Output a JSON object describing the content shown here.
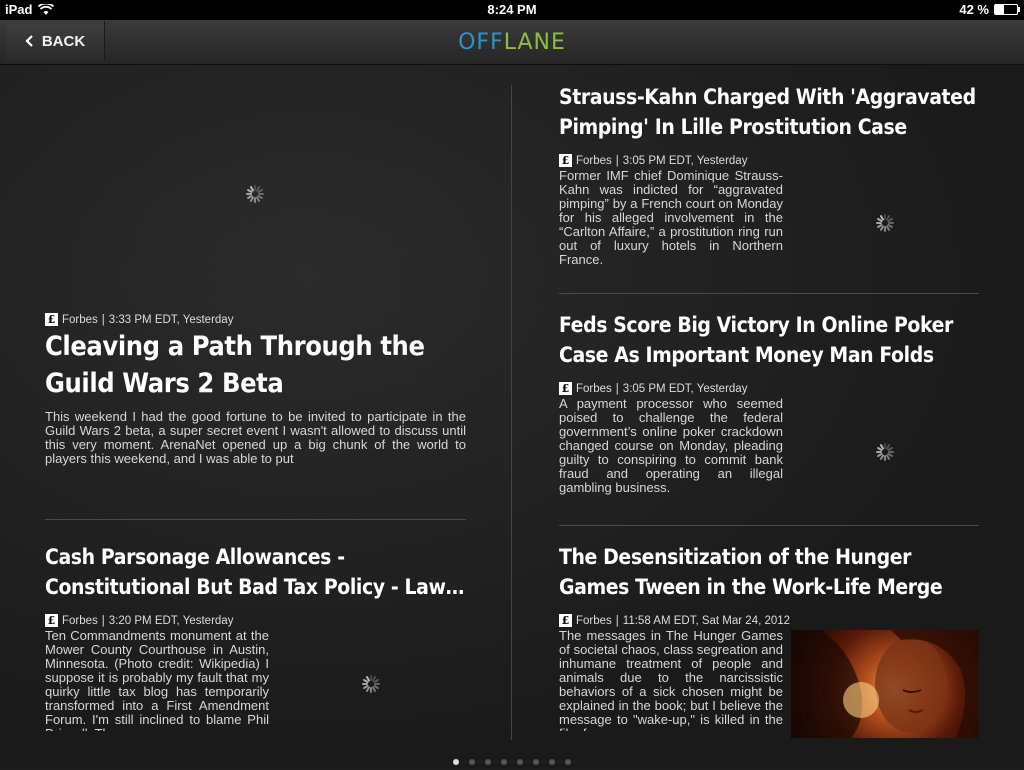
{
  "status_bar": {
    "device": "iPad",
    "time": "8:24 PM",
    "battery": "42 %",
    "battery_level": 0.42
  },
  "nav": {
    "back_label": "BACK",
    "logo_part1": "OFF",
    "logo_part2": "LANE"
  },
  "colors": {
    "logo_blue": "#2b95c9",
    "logo_green": "#8cbf3f"
  },
  "articles": [
    {
      "title": "Cleaving a Path Through the Guild Wars 2 Beta",
      "source": "Forbes",
      "time": "3:33 PM EDT, Yesterday",
      "body": "This weekend I had the good fortune to be invited to participate in the Guild Wars 2 beta, a super secret event I wasn't allowed to discuss until this very moment. ArenaNet opened up a big chunk of the world to players this weekend, and I was able to put"
    },
    {
      "title": "Strauss-Kahn Charged With 'Aggravated Pimping' In Lille Prostitution Case",
      "source": "Forbes",
      "time": "3:05 PM EDT, Yesterday",
      "body": "Former IMF chief Dominique Strauss-Kahn was indicted for “aggravated pimping” by a French court on Monday for his alleged involvement in the “Carlton Affaire,” a prostitution ring run out of luxury hotels in Northern France."
    },
    {
      "title": "Feds Score Big Victory In Online Poker Case As Important Money Man Folds",
      "source": "Forbes",
      "time": "3:05 PM EDT, Yesterday",
      "body": "A payment processor who seemed poised to challenge the federal government’s online poker crackdown changed course on Monday, pleading guilty to conspiring to commit bank fraud and operating an illegal gambling business."
    },
    {
      "title": "Cash Parsonage Allowances - Constitutional But Bad Tax Policy - Law…",
      "source": "Forbes",
      "time": "3:20 PM EDT, Yesterday",
      "body": "Ten Commandments monument at the Mower County Courthouse in Austin, Minnesota. (Photo credit: Wikipedia) I suppose it is probably my fault that my quirky little tax blog has temporarily transformed into a First Amendment Forum.  I'm still inclined to blame Phil Driscoll.  The"
    },
    {
      "title": "The Desensitization of the Hunger Games Tween in the Work-Life Merge",
      "source": "Forbes",
      "time": "11:58 AM EDT, Sat Mar 24, 2012",
      "body": "The messages in The Hunger Games of societal chaos, class segreation and inhumane treatment of people and animals due to the narcissistic behaviors of a sick chosen might be explained in the book; but I believe the message to \"wake-up,\" is killed in the film for"
    }
  ],
  "pagination": {
    "pages": 8,
    "current": 1
  }
}
